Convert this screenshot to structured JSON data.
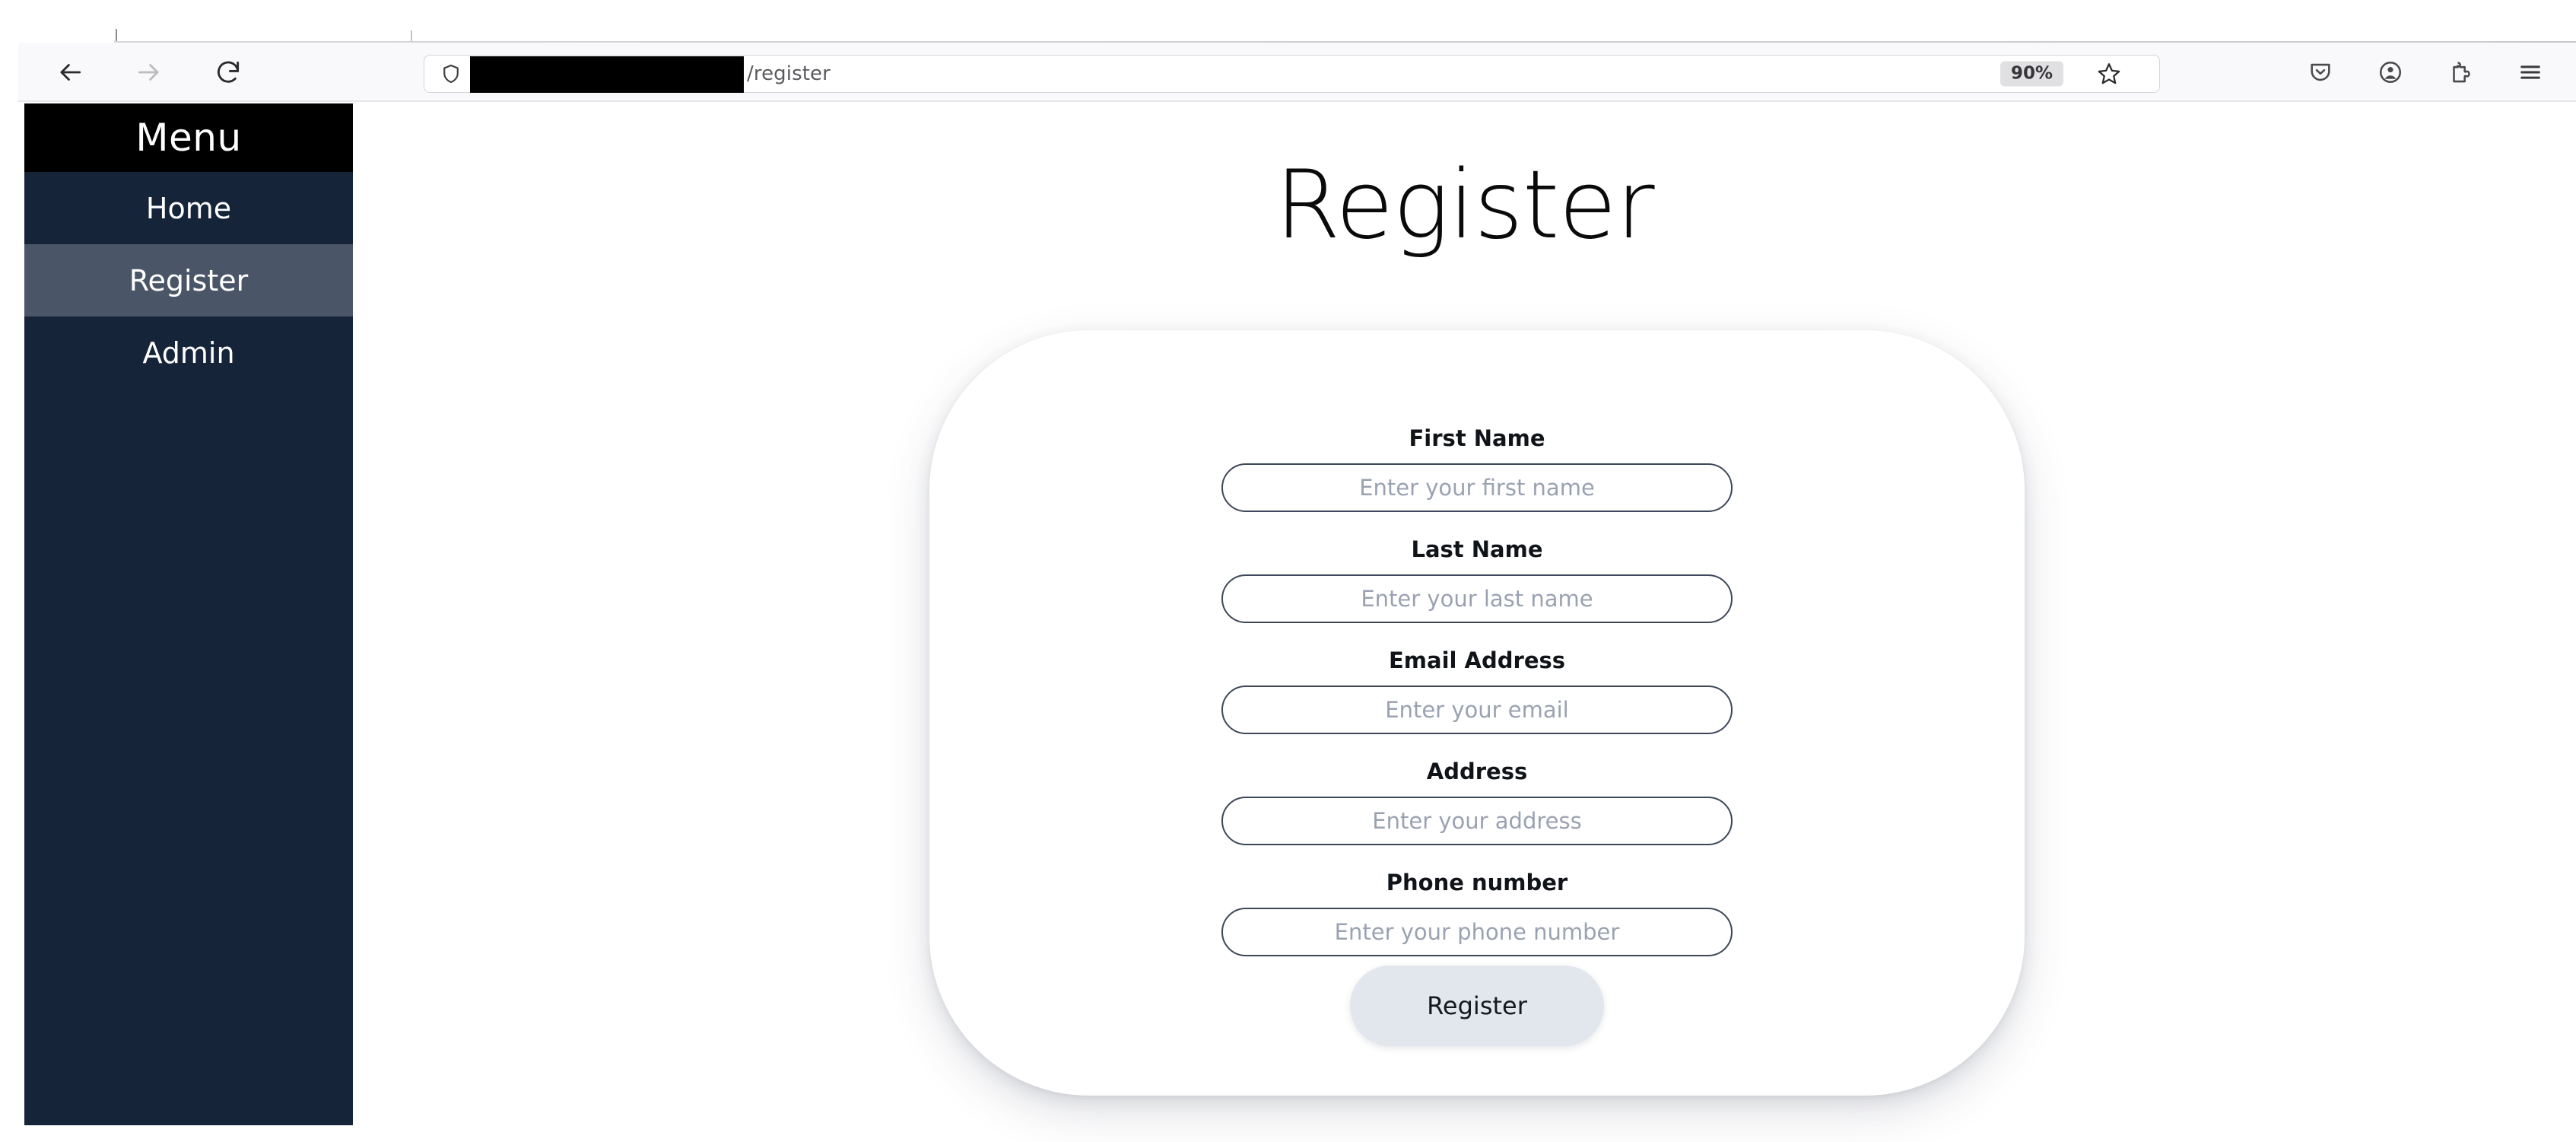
{
  "browser": {
    "nav": {
      "back_label": "Back",
      "forward_label": "Forward",
      "reload_label": "Reload"
    },
    "url": {
      "redacted": true,
      "visible_path": "/register",
      "shield_icon": "shield-icon"
    },
    "zoom_level": "90%",
    "bookmark_icon": "star-icon",
    "toolbar_icons": [
      {
        "name": "pocket-save-icon",
        "label": "Save to Pocket"
      },
      {
        "name": "account-icon",
        "label": "Account"
      },
      {
        "name": "extensions-icon",
        "label": "Extensions"
      },
      {
        "name": "app-menu-icon",
        "label": "Open application menu"
      }
    ]
  },
  "sidebar": {
    "title": "Menu",
    "items": [
      {
        "label": "Home",
        "active": false
      },
      {
        "label": "Register",
        "active": true
      },
      {
        "label": "Admin",
        "active": false
      }
    ],
    "colors": {
      "background": "#16243a",
      "title_background": "#000000",
      "active_background": "#4a5568",
      "text": "#ffffff"
    }
  },
  "main": {
    "page_title": "Register",
    "form": {
      "fields": [
        {
          "label": "First Name",
          "placeholder": "Enter your first name",
          "value": ""
        },
        {
          "label": "Last Name",
          "placeholder": "Enter your last name",
          "value": ""
        },
        {
          "label": "Email Address",
          "placeholder": "Enter your email",
          "value": ""
        },
        {
          "label": "Address",
          "placeholder": "Enter your address",
          "value": ""
        },
        {
          "label": "Phone number",
          "placeholder": "Enter your phone number",
          "value": ""
        }
      ],
      "submit_label": "Register",
      "submit_color": "#e2e6ed"
    }
  }
}
